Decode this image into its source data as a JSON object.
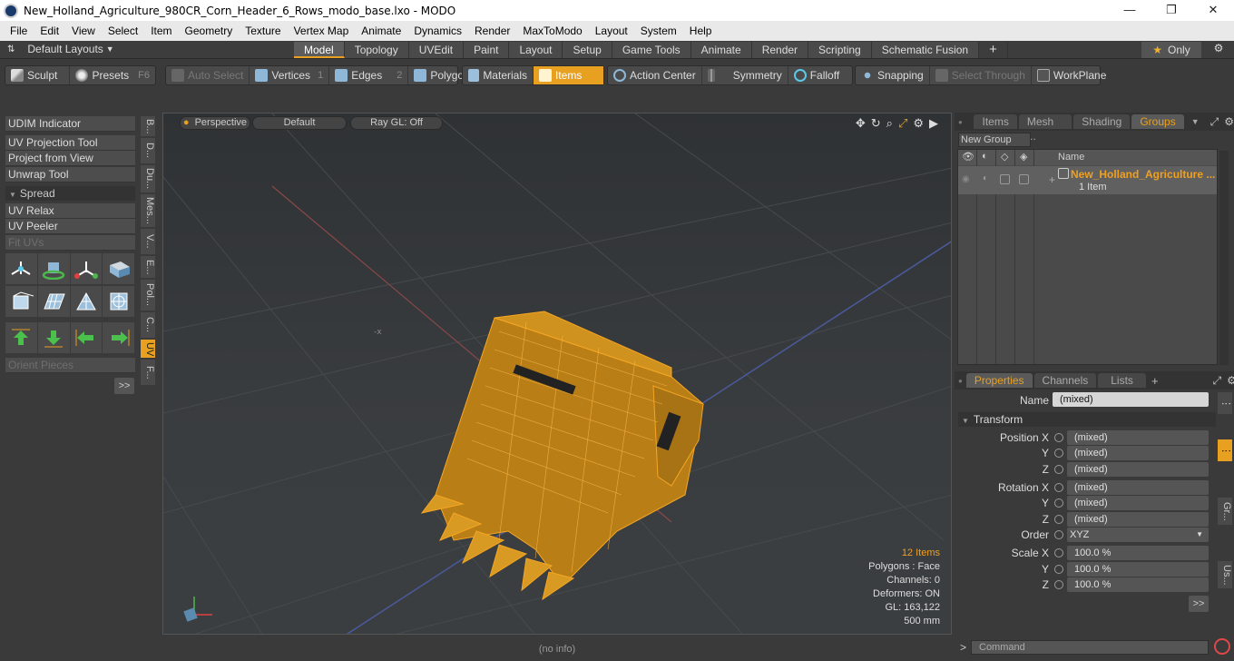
{
  "window": {
    "title": "New_Holland_Agriculture_980CR_Corn_Header_6_Rows_modo_base.lxo - MODO",
    "minimize": "—",
    "maximize": "❐",
    "close": "✕"
  },
  "menu": [
    "File",
    "Edit",
    "View",
    "Select",
    "Item",
    "Geometry",
    "Texture",
    "Vertex Map",
    "Animate",
    "Dynamics",
    "Render",
    "MaxToModo",
    "Layout",
    "System",
    "Help"
  ],
  "layout": {
    "selector": "Default Layouts",
    "tabs": [
      "Model",
      "Topology",
      "UVEdit",
      "Paint",
      "Layout",
      "Setup",
      "Game Tools",
      "Animate",
      "Render",
      "Scripting",
      "Schematic Fusion"
    ],
    "active_tab": "Model",
    "add": "+",
    "only": "Only"
  },
  "toolbar": {
    "sculpt": "Sculpt",
    "presets": "Presets",
    "presets_key": "F6",
    "auto_select": "Auto Select",
    "vertices": "Vertices",
    "vertices_key": "1",
    "edges": "Edges",
    "edges_key": "2",
    "polygons": "Polygons",
    "materials": "Materials",
    "items": "Items",
    "action_center": "Action Center",
    "symmetry": "Symmetry",
    "falloff": "Falloff",
    "snapping": "Snapping",
    "select_through": "Select Through",
    "workplane": "WorkPlane"
  },
  "left_panel": {
    "udim": "UDIM Indicator",
    "uv_projection": "UV Projection Tool",
    "project_from_view": "Project from View",
    "unwrap": "Unwrap Tool",
    "spread": "Spread",
    "uv_relax": "UV Relax",
    "uv_peeler": "UV Peeler",
    "fit_uvs": "Fit UVs",
    "orient_pieces": "Orient Pieces",
    "more": ">>",
    "vtabs": [
      "B...",
      "D...",
      "Du...",
      "Mes...",
      "V...",
      "E...",
      "Pol...",
      "C...",
      "UV",
      "F..."
    ]
  },
  "viewport": {
    "perspective": "Perspective",
    "default": "Default",
    "raygl": "Ray GL: Off",
    "stats": {
      "items": "12 Items",
      "polygons": "Polygons : Face",
      "channels": "Channels: 0",
      "deformers": "Deformers: ON",
      "gl": "GL: 163,122",
      "scale": "500 mm"
    }
  },
  "status": "(no info)",
  "groups_panel": {
    "tabs": [
      "Items",
      "Mesh ...",
      "Shading",
      "Groups"
    ],
    "active": "Groups",
    "new_group": "New Group",
    "col_name": "Name",
    "group_name": "New_Holland_Agriculture ...",
    "group_count": "1 Item"
  },
  "properties": {
    "tabs": [
      "Properties",
      "Channels",
      "Lists"
    ],
    "add": "+",
    "name_label": "Name",
    "name_value": "(mixed)",
    "transform": "Transform",
    "position_x": "Position X",
    "y": "Y",
    "z": "Z",
    "rotation_x": "Rotation X",
    "order": "Order",
    "order_value": "XYZ",
    "scale_x": "Scale X",
    "mixed": "(mixed)",
    "scale_value": "100.0 %",
    "more": ">>",
    "side_tabs": [
      "Gr...",
      "Us..."
    ]
  },
  "command": {
    "prompt": ">",
    "placeholder": "Command"
  },
  "colors": {
    "accent": "#e8a020",
    "wire": "#f5a623"
  }
}
